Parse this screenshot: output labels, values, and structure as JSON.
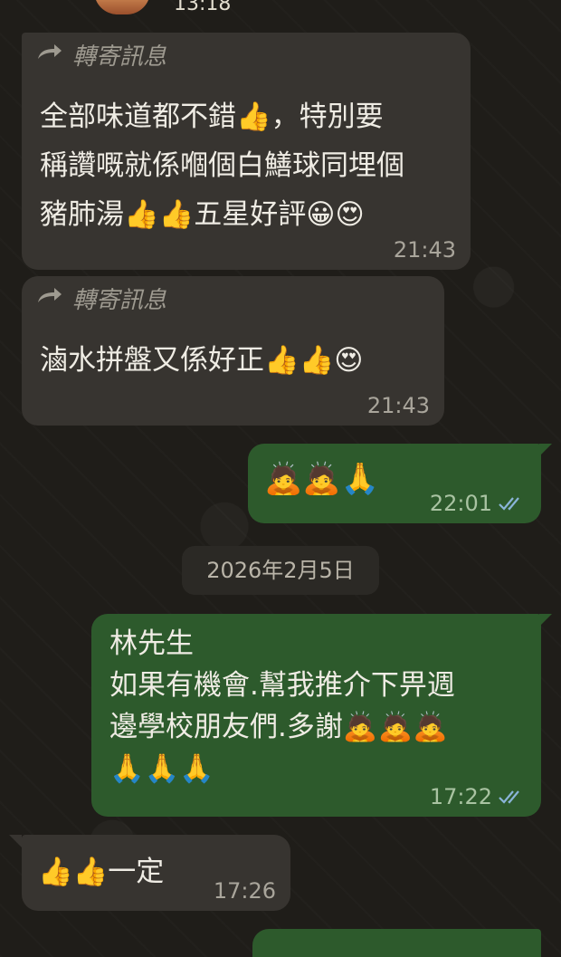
{
  "header": {
    "time": "13:18"
  },
  "messages": [
    {
      "forwarded_label": "轉寄訊息",
      "lines": [
        "全部味道都不錯👍，特別要",
        "稱讚嘅就係嗰個白鱔球同埋個",
        "豬肺湯👍👍五星好評😀😍"
      ],
      "time": "21:43"
    },
    {
      "forwarded_label": "轉寄訊息",
      "lines": [
        "滷水拼盤又係好正👍👍😍"
      ],
      "time": "21:43"
    },
    {
      "lines": [
        "🙇🙇🙏"
      ],
      "time": "22:01"
    },
    {
      "lines": [
        "林先生",
        "如果有機會.幫我推介下畀週",
        "邊學校朋友們.多謝🙇🙇🙇",
        "🙏🙏🙏"
      ],
      "time": "17:22"
    },
    {
      "lines": [
        "👍👍一定"
      ],
      "time": "17:26"
    }
  ],
  "date_separator": "2026年2月5日",
  "colors": {
    "incoming_bubble": "#373430",
    "outgoing_bubble": "#2d5a2c",
    "read_ticks": "#8ab4d8"
  }
}
